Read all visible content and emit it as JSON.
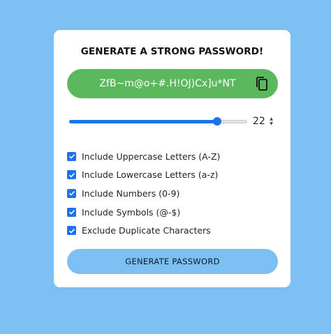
{
  "title": "GENERATE A STRONG PASSWORD!",
  "password": {
    "value": "ZfB~m@o+#.H!OJ)Cx]u*NT",
    "copy_icon": "copy-icon"
  },
  "length": {
    "value": "22",
    "slider_fraction": 0.83
  },
  "options": [
    {
      "label": "Include Uppercase Letters (A-Z)",
      "checked": true
    },
    {
      "label": "Include Lowercase Letters (a-z)",
      "checked": true
    },
    {
      "label": "Include Numbers (0-9)",
      "checked": true
    },
    {
      "label": "Include Symbols (@-$)",
      "checked": true
    },
    {
      "label": "Exclude Duplicate Characters",
      "checked": true
    }
  ],
  "button": {
    "label": "GENERATE PASSWORD"
  },
  "colors": {
    "background": "#7cbff2",
    "password_box": "#5cb85c",
    "accent": "#1a73e8"
  }
}
